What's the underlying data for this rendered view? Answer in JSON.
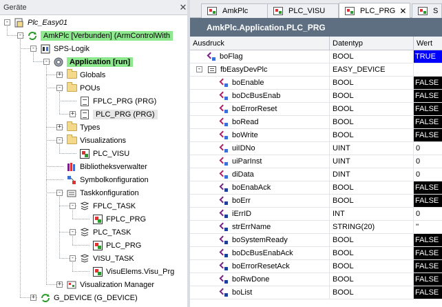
{
  "left_panel": {
    "title": "Geräte",
    "close_glyph": "✕",
    "tree": [
      {
        "id": "project",
        "label": "Plc_Easy01",
        "italic": true,
        "icon": "project-icon",
        "expander": "-",
        "level": 0
      },
      {
        "id": "device",
        "label": "AmkPlc [Verbunden] (ArmControlWith",
        "icon": "device-icon",
        "expander": "-",
        "level": 1,
        "highlight": "green"
      },
      {
        "id": "sps-logik",
        "label": "SPS-Logik",
        "icon": "plc-logic-icon",
        "expander": "-",
        "level": 2
      },
      {
        "id": "application",
        "label": "Application [run]",
        "icon": "application-icon",
        "expander": "-",
        "level": 3,
        "highlight": "green-bold"
      },
      {
        "id": "globals",
        "label": "Globals",
        "icon": "folder-icon",
        "expander": "+",
        "level": 4
      },
      {
        "id": "pous",
        "label": "POUs",
        "icon": "folder-icon",
        "expander": "-",
        "level": 4
      },
      {
        "id": "fplc-prg",
        "label": "FPLC_PRG (PRG)",
        "icon": "document-icon",
        "level": 5
      },
      {
        "id": "plc-prg",
        "label": "PLC_PRG (PRG)",
        "icon": "document-icon",
        "expander": "+",
        "level": 5,
        "highlight": "grey"
      },
      {
        "id": "types",
        "label": "Types",
        "icon": "folder-icon",
        "expander": "+",
        "level": 4
      },
      {
        "id": "visualizations",
        "label": "Visualizations",
        "icon": "folder-icon",
        "expander": "-",
        "level": 4
      },
      {
        "id": "plc-visu",
        "label": "PLC_VISU",
        "icon": "visu-icon",
        "level": 5
      },
      {
        "id": "bibliothek",
        "label": "Bibliotheksverwalter",
        "icon": "library-icon",
        "level": 4
      },
      {
        "id": "symbol",
        "label": "Symbolkonfiguration",
        "icon": "symbol-icon",
        "level": 4
      },
      {
        "id": "task-config",
        "label": "Taskkonfiguration",
        "icon": "task-config-icon",
        "expander": "-",
        "level": 4
      },
      {
        "id": "fplc-task",
        "label": "FPLC_TASK",
        "icon": "task-icon",
        "expander": "-",
        "level": 5
      },
      {
        "id": "fplc-prg-call",
        "label": "FPLC_PRG",
        "icon": "prg-call-icon",
        "level": 6
      },
      {
        "id": "plc-task",
        "label": "PLC_TASK",
        "icon": "task-icon",
        "expander": "-",
        "level": 5
      },
      {
        "id": "plc-prg-call",
        "label": "PLC_PRG",
        "icon": "prg-call-icon",
        "level": 6
      },
      {
        "id": "visu-task",
        "label": "VISU_TASK",
        "icon": "task-icon",
        "expander": "-",
        "level": 5
      },
      {
        "id": "visu-prg-call",
        "label": "VisuElems.Visu_Prg",
        "icon": "prg-call-icon",
        "level": 6
      },
      {
        "id": "visu-manager",
        "label": "Visualization Manager",
        "icon": "visu-manager-icon",
        "expander": "+",
        "level": 4
      },
      {
        "id": "g-device",
        "label": "G_DEVICE (G_DEVICE)",
        "icon": "device-icon",
        "expander": "+",
        "level": 2
      }
    ]
  },
  "tabs": [
    {
      "label": "AmkPlc",
      "active": false,
      "icon": "device-tab-icon"
    },
    {
      "label": "PLC_VISU",
      "active": false,
      "icon": "visu-tab-icon"
    },
    {
      "label": "PLC_PRG",
      "active": true,
      "icon": "prg-tab-icon",
      "close_glyph": "✕"
    },
    {
      "label": "S",
      "active": false,
      "icon": "tab-icon"
    }
  ],
  "path_title": "AmkPlc.Application.PLC_PRG",
  "grid": {
    "columns": [
      "Ausdruck",
      "Datentyp",
      "Wert"
    ],
    "rows": [
      {
        "name": "boFlag",
        "type": "BOOL",
        "value": "TRUE",
        "style": "true",
        "icon": "var-icon",
        "indent": 1
      },
      {
        "name": "fbEasyDevPlc",
        "type": "EASY_DEVICE",
        "value": "",
        "style": "plain",
        "icon": "fb-icon",
        "indent": 1,
        "expander": "-"
      },
      {
        "name": "boEnable",
        "type": "BOOL",
        "value": "FALSE",
        "style": "false",
        "icon": "input-var-icon",
        "indent": 2
      },
      {
        "name": "boDcBusEnab",
        "type": "BOOL",
        "value": "FALSE",
        "style": "false",
        "icon": "input-var-icon",
        "indent": 2
      },
      {
        "name": "boErrorReset",
        "type": "BOOL",
        "value": "FALSE",
        "style": "false",
        "icon": "input-var-icon",
        "indent": 2
      },
      {
        "name": "boRead",
        "type": "BOOL",
        "value": "FALSE",
        "style": "false",
        "icon": "input-var-icon",
        "indent": 2
      },
      {
        "name": "boWrite",
        "type": "BOOL",
        "value": "FALSE",
        "style": "false",
        "icon": "input-var-icon",
        "indent": 2
      },
      {
        "name": "uiIDNo",
        "type": "UINT",
        "value": "0",
        "style": "plain",
        "icon": "input-var-icon",
        "indent": 2
      },
      {
        "name": "uiParInst",
        "type": "UINT",
        "value": "0",
        "style": "plain",
        "icon": "input-var-icon",
        "indent": 2
      },
      {
        "name": "diData",
        "type": "DINT",
        "value": "0",
        "style": "plain",
        "icon": "input-var-icon",
        "indent": 2
      },
      {
        "name": "boEnabAck",
        "type": "BOOL",
        "value": "FALSE",
        "style": "false",
        "icon": "output-var-icon",
        "indent": 2
      },
      {
        "name": "boErr",
        "type": "BOOL",
        "value": "FALSE",
        "style": "false",
        "icon": "output-var-icon",
        "indent": 2
      },
      {
        "name": "iErrID",
        "type": "INT",
        "value": "0",
        "style": "plain",
        "icon": "output-var-icon",
        "indent": 2
      },
      {
        "name": "strErrName",
        "type": "STRING(20)",
        "value": "''",
        "style": "plain",
        "icon": "output-var-icon",
        "indent": 2
      },
      {
        "name": "boSystemReady",
        "type": "BOOL",
        "value": "FALSE",
        "style": "false",
        "icon": "output-var-icon",
        "indent": 2
      },
      {
        "name": "boDcBusEnabAck",
        "type": "BOOL",
        "value": "FALSE",
        "style": "false",
        "icon": "output-var-icon",
        "indent": 2
      },
      {
        "name": "boErrorResetAck",
        "type": "BOOL",
        "value": "FALSE",
        "style": "false",
        "icon": "output-var-icon",
        "indent": 2
      },
      {
        "name": "boRwDone",
        "type": "BOOL",
        "value": "FALSE",
        "style": "false",
        "icon": "output-var-icon",
        "indent": 2
      },
      {
        "name": "boList",
        "type": "BOOL",
        "value": "FALSE",
        "style": "false",
        "icon": "output-var-icon",
        "indent": 2
      }
    ]
  },
  "colors": {
    "path_bar": "#5f6f82",
    "highlight_green": "#8ee88e",
    "value_true": "#0000ff",
    "value_false": "#000000"
  }
}
